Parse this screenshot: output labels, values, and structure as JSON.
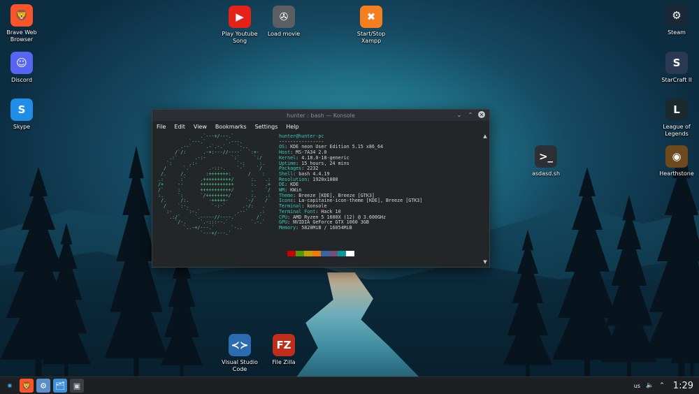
{
  "desktop": {
    "left_icons": [
      {
        "label": "Brave Web Browser",
        "icon": "brave-icon",
        "color": "#fb542b",
        "glyph": "🦁"
      },
      {
        "label": "Discord",
        "icon": "discord-icon",
        "color": "#5865f2",
        "glyph": "☺"
      },
      {
        "label": "Skype",
        "icon": "skype-icon",
        "color": "#1f8ee8",
        "glyph": "S"
      }
    ],
    "top_icons": [
      {
        "label": "Play Youtube Song",
        "icon": "youtube-icon",
        "color": "#e62117",
        "glyph": "▶"
      },
      {
        "label": "Load movie",
        "icon": "film-reel-icon",
        "color": "#5b5f63",
        "glyph": "✇"
      },
      {
        "label": "Start/Stop Xampp",
        "icon": "xampp-icon",
        "color": "#f57f20",
        "glyph": "✖"
      }
    ],
    "right_icons": [
      {
        "label": "Steam",
        "icon": "steam-icon",
        "color": "#1b2838",
        "glyph": "⚙"
      },
      {
        "label": "StarCraft II",
        "icon": "starcraft-icon",
        "color": "#2a3a55",
        "glyph": "S"
      },
      {
        "label": "League of Legends",
        "icon": "league-of-legends-icon",
        "color": "#1a2a2f",
        "glyph": "L"
      },
      {
        "label": "Hearthstone",
        "icon": "hearthstone-icon",
        "color": "#6c4a1c",
        "glyph": "◉"
      }
    ],
    "script_icon": {
      "label": "asdasd.sh",
      "icon": "shell-script-icon",
      "color": "#2c2f33",
      "glyph": ">_"
    },
    "bottom_icons": [
      {
        "label": "Visual Studio Code",
        "icon": "vscode-icon",
        "color": "#2b6cb0",
        "glyph": "≺≻"
      },
      {
        "label": "File Zilla",
        "icon": "filezilla-icon",
        "color": "#bf2e1a",
        "glyph": "FZ"
      }
    ]
  },
  "konsole": {
    "title": "hunter : bash — Konsole",
    "menu": [
      "File",
      "Edit",
      "View",
      "Bookmarks",
      "Settings",
      "Help"
    ],
    "ascii": [
      "               .`---+/---.`",
      "           `---.`       `.---.",
      "        .--`     .-`.-.`    `-..",
      "      /`/:      .-+:---//----`  `:+-",
      "    .:`      .-:-         `:`     `:/",
      "   `:      .:-              `-:     :.",
      "  /      `.`      .-::-.    `-`    `/",
      " /.     /.       :+++++++:      /    :",
      ".:      :`     .++++++++++/      :.   .:",
      "/+     --      ++++++++++++      :.   .+",
      "/`     :       +++++++++++/      .    `/",
      ":.     `:      `/++++++++/       :.   .:",
      " /.     /:.       -+++++-      `-/    /",
      "  /    `:-.        `-:-`      .-/:   .",
      "   :-     `:-.`             .--`    .:",
      "    .:/`     `.-----//----.`       /`",
      "      `/-.     `.-:::--.`        `.-.`",
      "         `..-+/---.`      `-..",
      "               `---+/---.`"
    ],
    "user_host": "hunter@hunter-pc",
    "separator": "----------------",
    "info": [
      {
        "k": "OS",
        "v": "KDE neon User Edition 5.15 x86_64"
      },
      {
        "k": "Host",
        "v": "MS-7A34 2.0"
      },
      {
        "k": "Kernel",
        "v": "4.18.0-18-generic"
      },
      {
        "k": "Uptime",
        "v": "15 hours, 24 mins"
      },
      {
        "k": "Packages",
        "v": "2232"
      },
      {
        "k": "Shell",
        "v": "bash 4.4.19"
      },
      {
        "k": "Resolution",
        "v": "1920x1080"
      },
      {
        "k": "DE",
        "v": "KDE"
      },
      {
        "k": "WM",
        "v": "KWin"
      },
      {
        "k": "Theme",
        "v": "Breeze [KDE], Breeze [GTK3]"
      },
      {
        "k": "Icons",
        "v": "La-capitaine-icon-theme [KDE], Breeze [GTK3]"
      },
      {
        "k": "Terminal",
        "v": "konsole"
      },
      {
        "k": "Terminal Font",
        "v": "Hack 10"
      },
      {
        "k": "CPU",
        "v": "AMD Ryzen 5 1600X (12) @ 3.600GHz"
      },
      {
        "k": "GPU",
        "v": "NVIDIA GeForce GTX 1060 3GB"
      },
      {
        "k": "Memory",
        "v": "5820MiB / 16054MiB"
      }
    ],
    "palette": [
      "#cc0000",
      "#4e9a06",
      "#c4a000",
      "#f57900",
      "#3465a4",
      "#75507b",
      "#06989a",
      "#ffffff"
    ]
  },
  "taskbar": {
    "launchers": [
      {
        "name": "app-launcher-icon",
        "glyph": "✷",
        "color": "#3daee9"
      },
      {
        "name": "brave-taskbar-icon",
        "glyph": "🦁",
        "color": "#fb542b"
      },
      {
        "name": "system-settings-icon",
        "glyph": "⚙",
        "color": "#5b8ec9"
      },
      {
        "name": "file-manager-icon",
        "glyph": "🗂",
        "color": "#3f8fd8"
      },
      {
        "name": "konsole-taskbar-icon",
        "glyph": "▣",
        "color": "#2a2e32"
      }
    ],
    "keyboard_layout": "us",
    "clock": "1:29"
  }
}
